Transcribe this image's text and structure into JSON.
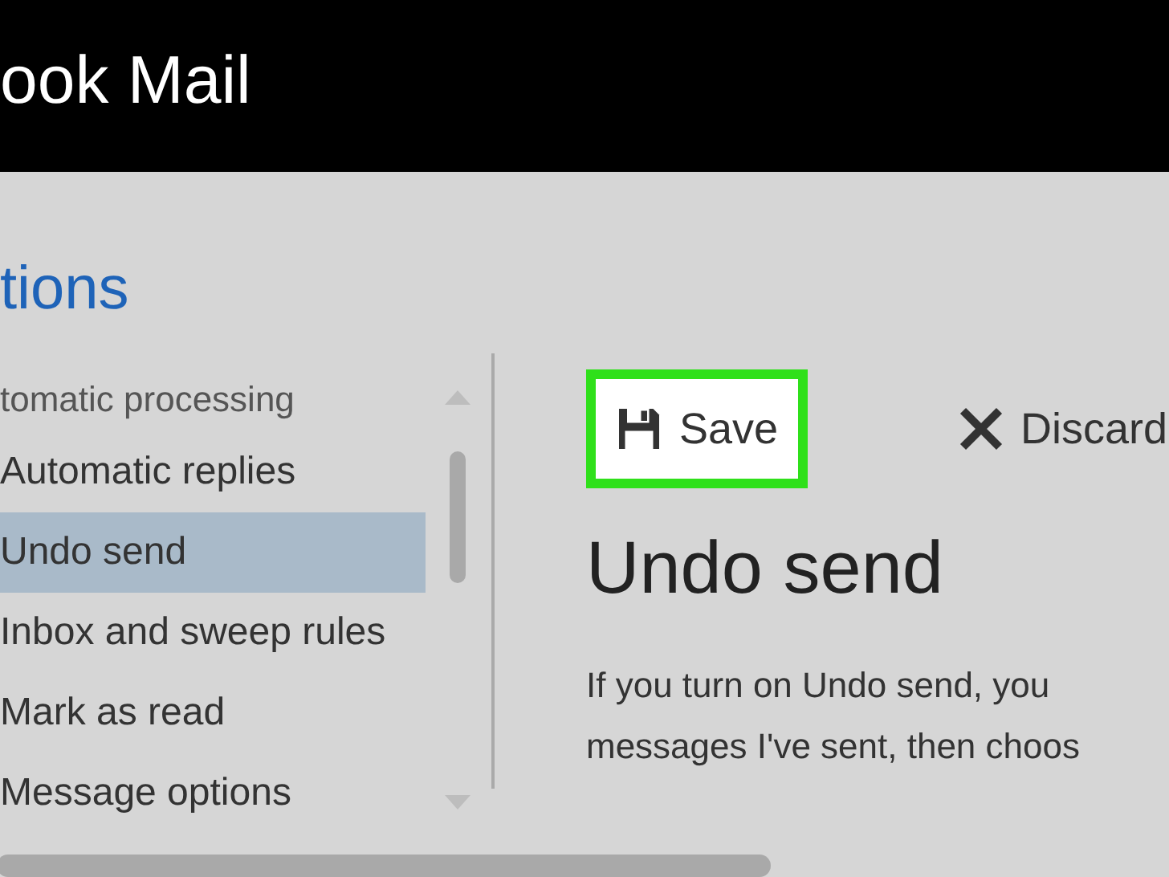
{
  "header": {
    "title": "ook Mail"
  },
  "page": {
    "title": "tions"
  },
  "sidebar": {
    "group_label": "tomatic processing",
    "items": [
      {
        "label": "Automatic replies",
        "selected": false
      },
      {
        "label": "Undo send",
        "selected": true
      },
      {
        "label": "Inbox and sweep rules",
        "selected": false
      },
      {
        "label": "Mark as read",
        "selected": false
      },
      {
        "label": "Message options",
        "selected": false
      }
    ]
  },
  "toolbar": {
    "buttons": [
      {
        "kind": "save",
        "label": "Save",
        "highlighted": true
      },
      {
        "kind": "discard",
        "label": "Discard",
        "highlighted": false
      }
    ]
  },
  "content": {
    "heading": "Undo send",
    "lines": [
      "If you turn on Undo send, you",
      "messages I've sent, then choos"
    ]
  }
}
